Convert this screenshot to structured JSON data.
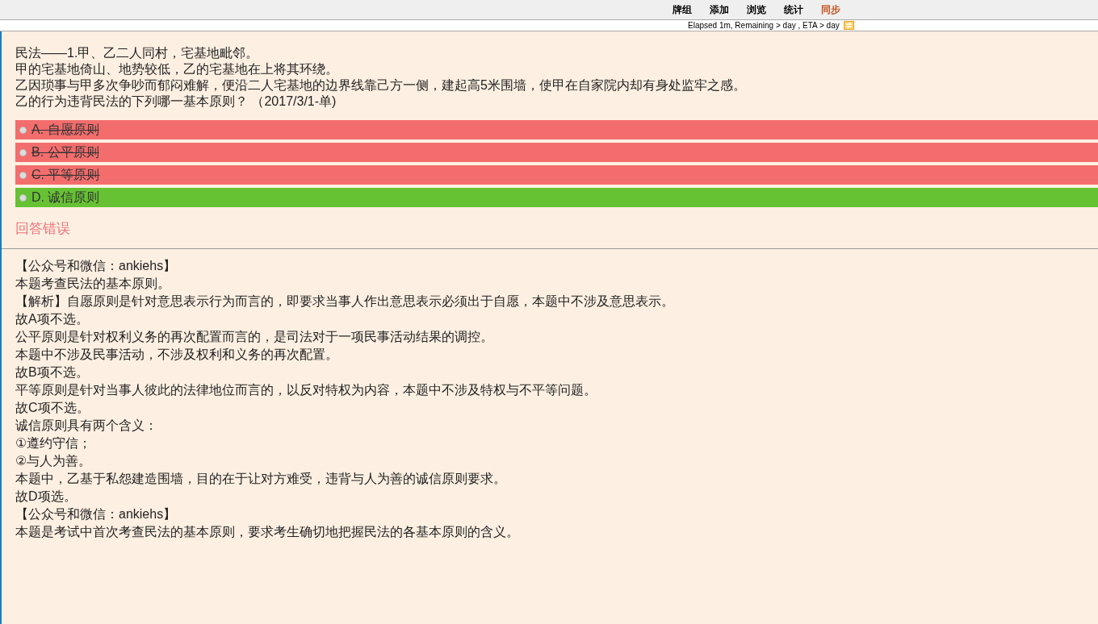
{
  "menu": [
    {
      "label": "牌组",
      "color": "#000000"
    },
    {
      "label": "添加",
      "color": "#000000"
    },
    {
      "label": "浏览",
      "color": "#000000"
    },
    {
      "label": "统计",
      "color": "#000000"
    },
    {
      "label": "同步",
      "color": "#c4501c"
    }
  ],
  "progress": {
    "text": "Elapsed 1m, Remaining > day , ETA > day"
  },
  "question": {
    "lines": [
      "民法——1.甲、乙二人同村，宅基地毗邻。",
      "甲的宅基地倚山、地势较低，乙的宅基地在上将其环绕。",
      "乙因琐事与甲多次争吵而郁闷难解，便沿二人宅基地的边界线靠己方一侧，建起高5米围墙，使甲在自家院内却有身处监牢之感。",
      "乙的行为违背民法的下列哪一基本原则？ （2017/3/1-单)"
    ]
  },
  "options": [
    {
      "label": "A. 自愿原则",
      "kind": "wrong"
    },
    {
      "label": "B. 公平原则",
      "kind": "wrong"
    },
    {
      "label": "C. 平等原则",
      "kind": "wrong"
    },
    {
      "label": "D. 诚信原则",
      "kind": "correct"
    }
  ],
  "result": "回答错误",
  "explanation": [
    "【公众号和微信：ankiehs】",
    "本题考查民法的基本原则。",
    "【解析】自愿原则是针对意思表示行为而言的，即要求当事人作出意思表示必须出于自愿，本题中不涉及意思表示。",
    "故A项不选。",
    "公平原则是针对权利义务的再次配置而言的，是司法对于一项民事活动结果的调控。",
    "本题中不涉及民事活动，不涉及权利和义务的再次配置。",
    "故B项不选。",
    "平等原则是针对当事人彼此的法律地位而言的，以反对特权为内容，本题中不涉及特权与不平等问题。",
    "故C项不选。",
    "诚信原则具有两个含义：",
    "①遵约守信；",
    "②与人为善。",
    "本题中，乙基于私怨建造围墙，目的在于让对方难受，违背与人为善的诚信原则要求。",
    "故D项选。",
    "【公众号和微信：ankiehs】",
    "本题是考试中首次考查民法的基本原则，要求考生确切地把握民法的各基本原则的含义。"
  ]
}
